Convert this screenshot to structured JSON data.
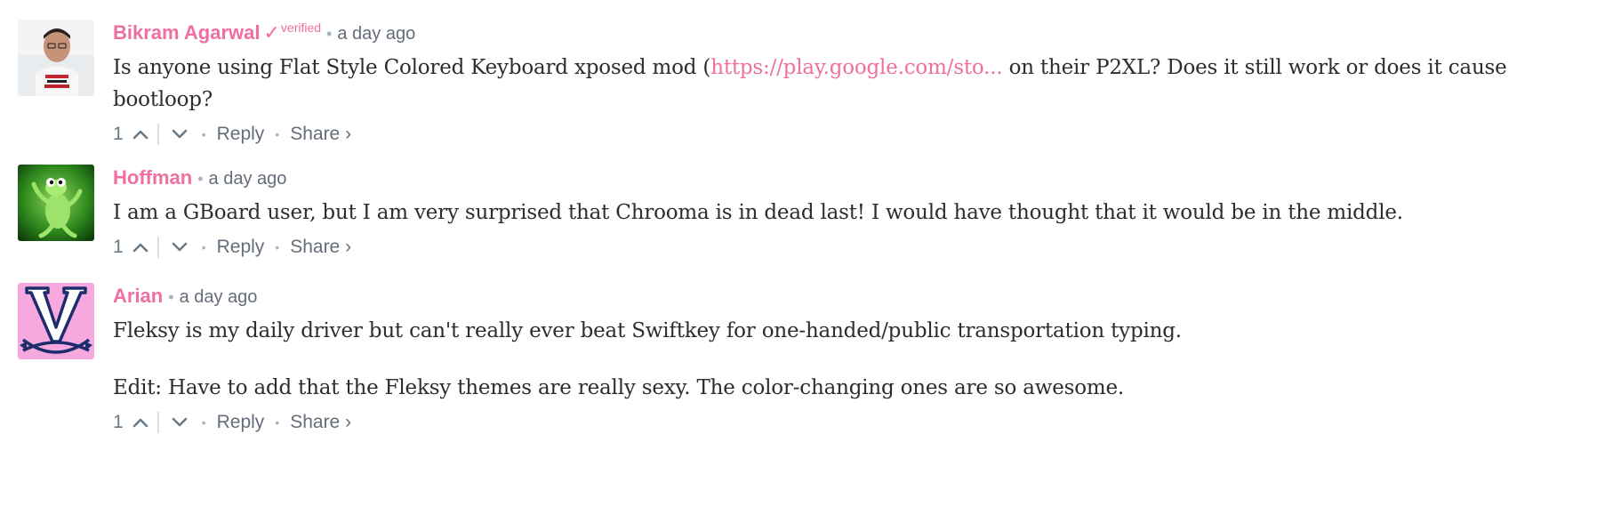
{
  "comments": [
    {
      "author": "Bikram Agarwal",
      "verified_mark": "✓",
      "verified_label": "verified",
      "separator": "•",
      "time": "a day ago",
      "text_before_link": "Is anyone using Flat Style Colored Keyboard xposed mod (",
      "link_text": "https://play.google.com/sto...",
      "text_after_link": " on their P2XL? Does it still work or does it cause bootloop?",
      "votes": "1",
      "reply_label": "Reply",
      "share_label": "Share ›",
      "avatar": "avatar-photo-man-tshirt"
    },
    {
      "author": "Hoffman",
      "separator": "•",
      "time": "a day ago",
      "text": "I am a GBoard user, but I am very surprised that Chrooma is in dead last! I would have thought that it would be in the middle.",
      "votes": "1",
      "reply_label": "Reply",
      "share_label": "Share ›",
      "avatar": "avatar-green-frog"
    },
    {
      "author": "Arian",
      "separator": "•",
      "time": "a day ago",
      "text_p1": "Fleksy is my daily driver but can't really ever beat Swiftkey for one-handed/public transportation typing.",
      "text_p2": "Edit: Have to add that the Fleksy themes are really sexy. The color-changing ones are so awesome.",
      "votes": "1",
      "reply_label": "Reply",
      "share_label": "Share ›",
      "avatar": "avatar-v-sabres-logo"
    }
  ],
  "footer_separator": "•",
  "colors": {
    "author": "#ee6fa0",
    "meta": "#687a86",
    "text": "#2a2e2e",
    "link": "#ee6fa0",
    "avatar_pink": "#f5a9df",
    "avatar_navy": "#1d2c6b"
  }
}
